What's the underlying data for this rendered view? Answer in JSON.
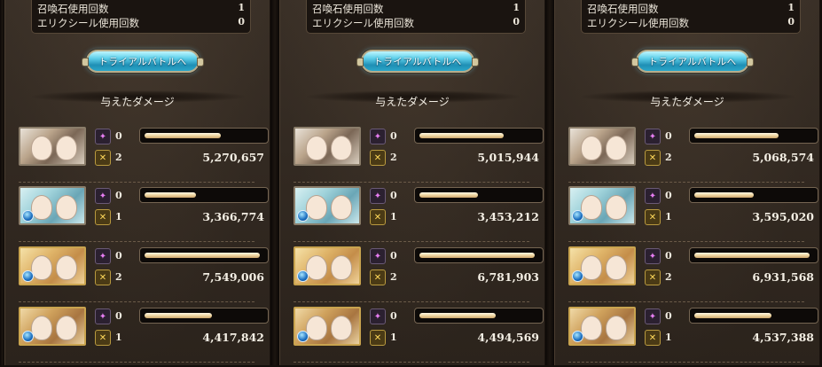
{
  "labels": {
    "summon_uses": "召喚石使用回数",
    "elixir_uses": "エリクシール使用回数",
    "trial_button": "トライアルバトルへ",
    "damage_title": "与えたダメージ"
  },
  "panels": [
    {
      "summon_uses": "1",
      "elixir_uses": "0",
      "characters": [
        {
          "icon": "two-girls-portrait",
          "ougi_count": "0",
          "chain_count": "2",
          "damage": "5,270,657",
          "bar_fraction": 0.64
        },
        {
          "icon": "blue-hair-girl-portrait",
          "ougi_count": "0",
          "chain_count": "1",
          "damage": "3,366,774",
          "bar_fraction": 0.43
        },
        {
          "icon": "blonde-girl-portrait",
          "ougi_count": "0",
          "chain_count": "2",
          "damage": "7,549,006",
          "bar_fraction": 0.97
        },
        {
          "icon": "brown-hair-girl-portrait",
          "ougi_count": "0",
          "chain_count": "1",
          "damage": "4,417,842",
          "bar_fraction": 0.57
        }
      ]
    },
    {
      "summon_uses": "1",
      "elixir_uses": "0",
      "characters": [
        {
          "icon": "two-girls-portrait",
          "ougi_count": "0",
          "chain_count": "2",
          "damage": "5,015,944",
          "bar_fraction": 0.71
        },
        {
          "icon": "blue-hair-girl-portrait",
          "ougi_count": "0",
          "chain_count": "1",
          "damage": "3,453,212",
          "bar_fraction": 0.49
        },
        {
          "icon": "blonde-girl-portrait",
          "ougi_count": "0",
          "chain_count": "2",
          "damage": "6,781,903",
          "bar_fraction": 0.97
        },
        {
          "icon": "brown-hair-girl-portrait",
          "ougi_count": "0",
          "chain_count": "1",
          "damage": "4,494,569",
          "bar_fraction": 0.64
        }
      ]
    },
    {
      "summon_uses": "1",
      "elixir_uses": "0",
      "characters": [
        {
          "icon": "two-girls-portrait",
          "ougi_count": "0",
          "chain_count": "2",
          "damage": "5,068,574",
          "bar_fraction": 0.71
        },
        {
          "icon": "blue-hair-girl-portrait",
          "ougi_count": "0",
          "chain_count": "1",
          "damage": "3,595,020",
          "bar_fraction": 0.5
        },
        {
          "icon": "blonde-girl-portrait",
          "ougi_count": "0",
          "chain_count": "2",
          "damage": "6,931,568",
          "bar_fraction": 0.97
        },
        {
          "icon": "brown-hair-girl-portrait",
          "ougi_count": "0",
          "chain_count": "1",
          "damage": "4,537,388",
          "bar_fraction": 0.65
        }
      ]
    }
  ],
  "colors": {
    "panel_bg": "#322921",
    "button_cyan": "#5fd0ea",
    "bar_fill": "#f1d8a3",
    "ougi_icon": "#e57df0",
    "chain_icon": "#ffd95a"
  },
  "icons": {
    "ougi": "ougi-star-icon",
    "chain": "chain-burst-icon",
    "element": "water-element-icon"
  }
}
